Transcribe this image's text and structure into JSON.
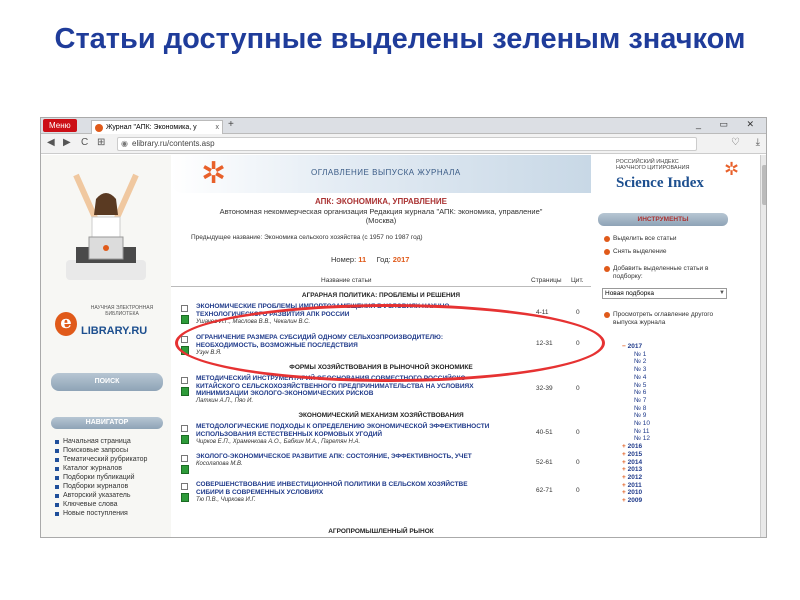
{
  "slide": {
    "title": "Статьи доступные выделены зеленым значком"
  },
  "browser": {
    "menu_label": "Меню",
    "tab_title": "Журнал \"АПК: Экономика, у",
    "tab_close": "x",
    "new_tab": "+",
    "url": "elibrary.ru/contents.asp",
    "back_icon": "◀",
    "forward_icon": "▶",
    "reload_icon": "C",
    "grid_icon": "⊞"
  },
  "left": {
    "logo_caption": "НАУЧНАЯ ЭЛЕКТРОННАЯ БИБЛИОТЕКА",
    "logo_letter": "e",
    "logo_text": "LIBRARY.RU",
    "search_label": "ПОИСК",
    "navigator_label": "НАВИГАТОР",
    "nav_items": [
      "Начальная страница",
      "Поисковые запросы",
      "Тематический рубрикатор",
      "Каталог журналов",
      "Подборки публикаций",
      "Подборки журналов",
      "Авторский указатель",
      "Ключевые слова",
      "Новые поступления"
    ]
  },
  "center": {
    "banner_title": "ОГЛАВЛЕНИЕ ВЫПУСКА ЖУРНАЛА",
    "journal_title": "АПК: ЭКОНОМИКА, УПРАВЛЕНИЕ",
    "org_line1": "Автономная некоммерческая организация Редакция журнала \"АПК: экономика, управление\"",
    "org_line2": "(Москва)",
    "prev_name": "Предыдущее название:  Экономика сельского хозяйства (с 1957 по 1987 год)",
    "issue_label": "Номер:",
    "issue_num": "11",
    "year_label": "Год:",
    "year": "2017",
    "col_title": "Название статьи",
    "col_pages": "Страницы",
    "col_cit": "Цит.",
    "sections": [
      "АГРАРНАЯ ПОЛИТИКА: ПРОБЛЕМЫ И РЕШЕНИЯ",
      "ФОРМЫ ХОЗЯЙСТВОВАНИЯ В РЫНОЧНОЙ ЭКОНОМИКЕ",
      "ЭКОНОМИЧЕСКИЙ МЕХАНИЗМ ХОЗЯЙСТВОВАНИЯ",
      "АГРОПРОМЫШЛЕННЫЙ РЫНОК"
    ],
    "articles": [
      {
        "title": "ЭКОНОМИЧЕСКИЕ ПРОБЛЕМЫ ИМПОРТОЗАМЕЩЕНИЯ В УСЛОВИЯХ НАУЧНО-ТЕХНОЛОГИЧЕСКОГО РАЗВИТИЯ АПК РОССИИ",
        "authors": "Ушачев И.Г., Маслова В.В., Чекалин В.С.",
        "pages": "4-11",
        "cit": "0"
      },
      {
        "title": "ОГРАНИЧЕНИЕ РАЗМЕРА СУБСИДИЙ ОДНОМУ СЕЛЬХОЗПРОИЗВОДИТЕЛЮ: НЕОБХОДИМОСТЬ, ВОЗМОЖНЫЕ ПОСЛЕДСТВИЯ",
        "authors": "Узун В.Я.",
        "pages": "12-31",
        "cit": "0"
      },
      {
        "title": "МЕТОДИЧЕСКИЙ ИНСТРУМЕНТАРИЙ ОБОСНОВАНИЯ СОВМЕСТНОГО РОССИЙСКО-КИТАЙСКОГО СЕЛЬСКОХОЗЯЙСТВЕННОГО ПРЕДПРИНИМАТЕЛЬСТВА НА УСЛОВИЯХ МИНИМИЗАЦИИ ЭКОЛОГО-ЭКОНОМИЧЕСКИХ РИСКОВ",
        "authors": "Латкин А.П., Пяо И.",
        "pages": "32-39",
        "cit": "0"
      },
      {
        "title": "МЕТОДОЛОГИЧЕСКИЕ ПОДХОДЫ К ОПРЕДЕЛЕНИЮ ЭКОНОМИЧЕСКОЙ ЭФФЕКТИВНОСТИ ИСПОЛЬЗОВАНИЯ ЕСТЕСТВЕННЫХ КОРМОВЫХ УГОДИЙ",
        "authors": "Чирков Е.П., Храменкова А.О., Бабкин М.А., Паретян Н.А.",
        "pages": "40-51",
        "cit": "0"
      },
      {
        "title": "ЭКОЛОГО-ЭКОНОМИЧЕСКОЕ РАЗВИТИЕ АПК: СОСТОЯНИЕ, ЭФФЕКТИВНОСТЬ, УЧЕТ",
        "authors": "Косолапова М.В.",
        "pages": "52-61",
        "cit": "0"
      },
      {
        "title": "СОВЕРШЕНСТВОВАНИЕ ИНВЕСТИЦИОННОЙ ПОЛИТИКИ В СЕЛЬСКОМ ХОЗЯЙСТВЕ СИБИРИ В СОВРЕМЕННЫХ УСЛОВИЯХ",
        "authors": "Тю П.В., Чиркова И.Г.",
        "pages": "62-71",
        "cit": "0"
      }
    ]
  },
  "right": {
    "rinc_line1": "РОССИЙСКИЙ ИНДЕКС",
    "rinc_line2": "НАУЧНОГО ЦИТИРОВАНИЯ",
    "science_index": "Science Index",
    "tools_label": "ИНСТРУМЕНТЫ",
    "select_all": "Выделить все статьи",
    "unselect": "Снять выделение",
    "add_selected": "Добавить выделенные статьи в подборку:",
    "new_collection": "Новая подборка",
    "view_other": "Просмотреть оглавление другого выпуска журнала",
    "open_year": "2017",
    "issues": [
      "№ 1",
      "№ 2",
      "№ 3",
      "№ 4",
      "№ 5",
      "№ 6",
      "№ 7",
      "№ 8",
      "№ 9",
      "№ 10",
      "№ 11",
      "№ 12"
    ],
    "other_years": [
      "2016",
      "2015",
      "2014",
      "2013",
      "2012",
      "2011",
      "2010",
      "2009"
    ]
  },
  "colors": {
    "accent": "#e05a1a",
    "title_blue": "#1f3c9a",
    "highlight_oval": "#e63232",
    "available_icon": "#2e9b3a"
  }
}
